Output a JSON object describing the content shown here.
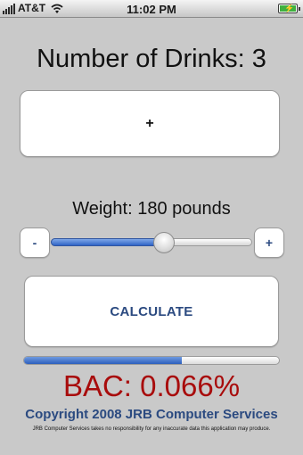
{
  "status_bar": {
    "carrier": "AT&T",
    "time": "11:02 PM",
    "signal_bars": 5,
    "wifi_icon": "wifi-icon",
    "battery_icon": "battery-charging-icon",
    "battery_level": 1.0
  },
  "drinks": {
    "label": "Number of Drinks: 3",
    "add_button_label": "+"
  },
  "weight": {
    "label": "Weight: 180 pounds",
    "decrease_label": "-",
    "increase_label": "+",
    "slider_fraction": 0.56
  },
  "calculate": {
    "button_label": "CALCULATE"
  },
  "bac": {
    "progress_fraction": 0.62,
    "result": "BAC: 0.066%"
  },
  "footer": {
    "copyright": "Copyright 2008 JRB Computer Services",
    "disclaimer": "JRB Computer Services takes no responsibility for any inaccurate data this application may produce."
  },
  "colors": {
    "background": "#c9c9c9",
    "accent_blue": "#2b4a80",
    "bac_red": "#a80c0c",
    "battery_green": "#3fb03f"
  }
}
